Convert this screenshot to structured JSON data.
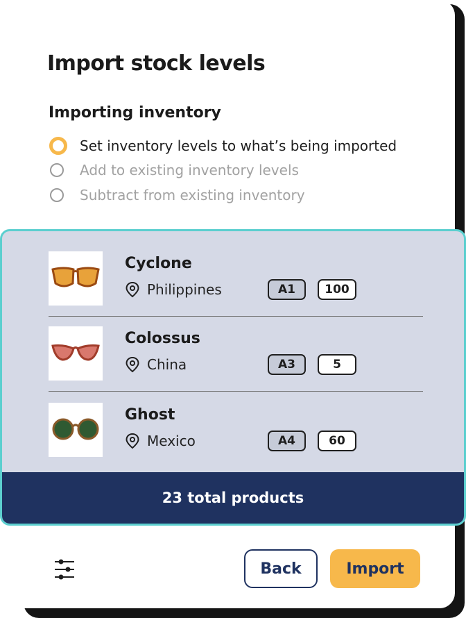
{
  "dialog": {
    "title": "Import stock levels",
    "section_title": "Importing inventory",
    "options": [
      {
        "label": "Set inventory levels to what’s being imported",
        "selected": true
      },
      {
        "label": "Add to existing inventory levels",
        "selected": false
      },
      {
        "label": "Subtract from existing inventory",
        "selected": false
      }
    ]
  },
  "products": [
    {
      "name": "Cyclone",
      "location": "Philippines",
      "bin": "A1",
      "quantity": "100",
      "lens_color": "#e8a23a",
      "frame_color": "#9a4a12"
    },
    {
      "name": "Colossus",
      "location": "China",
      "bin": "A3",
      "quantity": "5",
      "lens_color": "#d9786d",
      "frame_color": "#a13c2a"
    },
    {
      "name": "Ghost",
      "location": "Mexico",
      "bin": "A4",
      "quantity": "60",
      "lens_color": "#2f5a32",
      "frame_color": "#8a5a2a"
    }
  ],
  "summary": {
    "total_text": "23 total products"
  },
  "actions": {
    "back_label": "Back",
    "import_label": "Import",
    "filter_icon": "sliders-icon"
  },
  "colors": {
    "accent": "#f7b84b",
    "navy": "#1f3260",
    "panel_border": "#5ccfcf",
    "panel_bg": "#d5d9e6"
  }
}
